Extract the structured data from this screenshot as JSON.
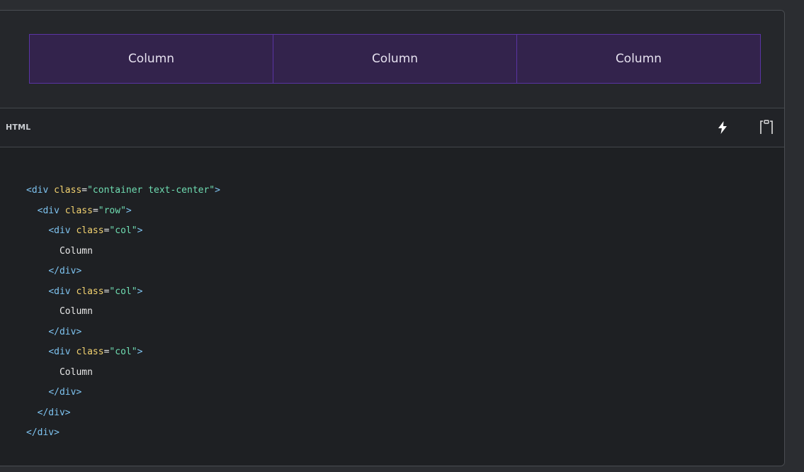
{
  "preview": {
    "columns": [
      "Column",
      "Column",
      "Column"
    ]
  },
  "code_header": {
    "language": "HTML",
    "actions": [
      {
        "icon": "lightning-icon"
      },
      {
        "icon": "copy-icon"
      }
    ]
  },
  "code": {
    "lines": [
      {
        "indent": "",
        "tokens": [
          {
            "t": "tag",
            "v": "<div"
          },
          {
            "t": "txt",
            "v": " "
          },
          {
            "t": "attr",
            "v": "class"
          },
          {
            "t": "txt",
            "v": "="
          },
          {
            "t": "str",
            "v": "\"container text-center\""
          },
          {
            "t": "tag",
            "v": ">"
          }
        ]
      },
      {
        "indent": "  ",
        "tokens": [
          {
            "t": "tag",
            "v": "<div"
          },
          {
            "t": "txt",
            "v": " "
          },
          {
            "t": "attr",
            "v": "class"
          },
          {
            "t": "txt",
            "v": "="
          },
          {
            "t": "str",
            "v": "\"row\""
          },
          {
            "t": "tag",
            "v": ">"
          }
        ]
      },
      {
        "indent": "    ",
        "tokens": [
          {
            "t": "tag",
            "v": "<div"
          },
          {
            "t": "txt",
            "v": " "
          },
          {
            "t": "attr",
            "v": "class"
          },
          {
            "t": "txt",
            "v": "="
          },
          {
            "t": "str",
            "v": "\"col\""
          },
          {
            "t": "tag",
            "v": ">"
          }
        ]
      },
      {
        "indent": "      ",
        "tokens": [
          {
            "t": "txt",
            "v": "Column"
          }
        ]
      },
      {
        "indent": "    ",
        "tokens": [
          {
            "t": "tag",
            "v": "</div>"
          }
        ]
      },
      {
        "indent": "    ",
        "tokens": [
          {
            "t": "tag",
            "v": "<div"
          },
          {
            "t": "txt",
            "v": " "
          },
          {
            "t": "attr",
            "v": "class"
          },
          {
            "t": "txt",
            "v": "="
          },
          {
            "t": "str",
            "v": "\"col\""
          },
          {
            "t": "tag",
            "v": ">"
          }
        ]
      },
      {
        "indent": "      ",
        "tokens": [
          {
            "t": "txt",
            "v": "Column"
          }
        ]
      },
      {
        "indent": "    ",
        "tokens": [
          {
            "t": "tag",
            "v": "</div>"
          }
        ]
      },
      {
        "indent": "    ",
        "tokens": [
          {
            "t": "tag",
            "v": "<div"
          },
          {
            "t": "txt",
            "v": " "
          },
          {
            "t": "attr",
            "v": "class"
          },
          {
            "t": "txt",
            "v": "="
          },
          {
            "t": "str",
            "v": "\"col\""
          },
          {
            "t": "tag",
            "v": ">"
          }
        ]
      },
      {
        "indent": "      ",
        "tokens": [
          {
            "t": "txt",
            "v": "Column"
          }
        ]
      },
      {
        "indent": "    ",
        "tokens": [
          {
            "t": "tag",
            "v": "</div>"
          }
        ]
      },
      {
        "indent": "  ",
        "tokens": [
          {
            "t": "tag",
            "v": "</div>"
          }
        ]
      },
      {
        "indent": "",
        "tokens": [
          {
            "t": "tag",
            "v": "</div>"
          }
        ]
      }
    ]
  },
  "colors": {
    "page_bg": "#2b2d31",
    "panel_bg": "#1e2023",
    "column_bg": "#33234c",
    "column_border": "#5a34a3",
    "tag": "#7ec3f0",
    "attr": "#f2d270",
    "string": "#6fdcb1",
    "text": "#e8e8e8"
  }
}
